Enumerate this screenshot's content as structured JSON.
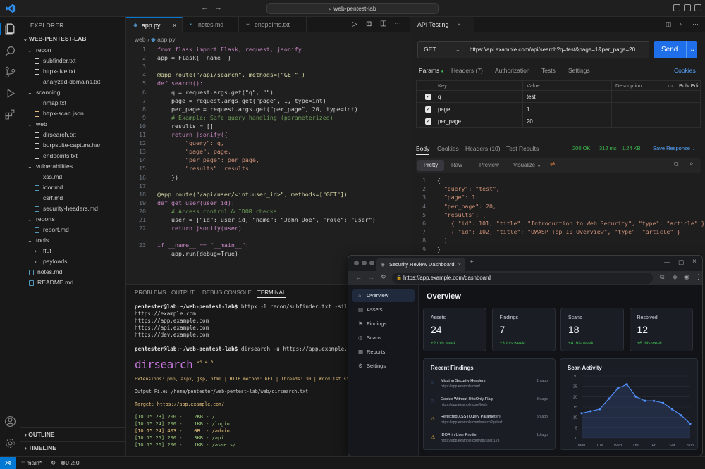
{
  "titlebar": {
    "search": "web-pentest-lab"
  },
  "sidebar": {
    "title": "EXPLORER",
    "project": "WEB-PENTEST-LAB",
    "tree": [
      {
        "label": "recon",
        "type": "folder",
        "open": true,
        "depth": 1
      },
      {
        "label": "subfinder.txt",
        "type": "file",
        "depth": 2,
        "color": "#cccccc"
      },
      {
        "label": "httpx-live.txt",
        "type": "file",
        "depth": 2,
        "color": "#cccccc"
      },
      {
        "label": "analyzed-domains.txt",
        "type": "file",
        "depth": 2,
        "color": "#cccccc"
      },
      {
        "label": "scanning",
        "type": "folder",
        "open": true,
        "depth": 1
      },
      {
        "label": "nmap.txt",
        "type": "file",
        "depth": 2,
        "color": "#cccccc"
      },
      {
        "label": "httpx-scan.json",
        "type": "file",
        "depth": 2,
        "color": "#e5c07b"
      },
      {
        "label": "web",
        "type": "folder",
        "open": true,
        "depth": 1
      },
      {
        "label": "dirsearch.txt",
        "type": "file",
        "depth": 2,
        "color": "#cccccc"
      },
      {
        "label": "burpsuite-capture.har",
        "type": "file",
        "depth": 2,
        "color": "#cccccc"
      },
      {
        "label": "endpoints.txt",
        "type": "file",
        "depth": 2,
        "color": "#cccccc"
      },
      {
        "label": "vulnerabilities",
        "type": "folder",
        "open": true,
        "depth": 1
      },
      {
        "label": "xss.md",
        "type": "file",
        "depth": 2,
        "color": "#519aba"
      },
      {
        "label": "idor.md",
        "type": "file",
        "depth": 2,
        "color": "#519aba"
      },
      {
        "label": "csrf.md",
        "type": "file",
        "depth": 2,
        "color": "#519aba"
      },
      {
        "label": "security-headers.md",
        "type": "file",
        "depth": 2,
        "color": "#519aba"
      },
      {
        "label": "reports",
        "type": "folder",
        "open": true,
        "depth": 1
      },
      {
        "label": "report.md",
        "type": "file",
        "depth": 2,
        "color": "#519aba"
      },
      {
        "label": "tools",
        "type": "folder",
        "open": true,
        "depth": 1
      },
      {
        "label": "ffuf",
        "type": "folder",
        "open": false,
        "depth": 2
      },
      {
        "label": "payloads",
        "type": "folder",
        "open": false,
        "depth": 2
      },
      {
        "label": "notes.md",
        "type": "file",
        "depth": 1,
        "color": "#519aba"
      },
      {
        "label": "README.md",
        "type": "file",
        "depth": 1,
        "color": "#519aba"
      }
    ],
    "outline": "OUTLINE",
    "timeline": "TIMELINE"
  },
  "editor": {
    "tabs": [
      "app.py",
      "notes.md",
      "endpoints.txt"
    ],
    "breadcrumb": [
      "web",
      "app.py"
    ],
    "lines": [
      "from flask import Flask, request, jsonify",
      "app = Flask(__name__)",
      "",
      "@app.route(\"/api/search\", methods=[\"GET\"])",
      "def search():",
      "    q = request.args.get(\"q\", \"\")",
      "    page = request.args.get(\"page\", 1, type=int)",
      "    per_page = request.args.get(\"per_page\", 20, type=int)",
      "    # Example: Safe query handling (parameterized)",
      "    results = []",
      "    return jsonify({",
      "        \"query\": q,",
      "        \"page\": page,",
      "        \"per_page\": per_page,",
      "        \"results\": results",
      "    })",
      "",
      "@app.route(\"/api/user/<int:user_id>\", methods=[\"GET\"])",
      "def get_user(user_id):",
      "    # Access control & IDOR checks",
      "    user = {\"id\": user_id, \"name\": \"John Doe\", \"role\": \"user\"}",
      "    return jsonify(user)",
      "",
      "if __name__ == \"__main__\":",
      "    app.run(debug=True)"
    ],
    "line_numbers": [
      "1",
      "2",
      "3",
      "4",
      "5",
      "6",
      "7",
      "8",
      "9",
      "10",
      "11",
      "12",
      "13",
      "14",
      "15",
      "16",
      "17",
      "18",
      "19",
      "20",
      "21",
      "22",
      "",
      "23"
    ]
  },
  "panel": {
    "tabs": [
      "PROBLEMS",
      "OUTPUT",
      "DEBUG CONSOLE",
      "TERMINAL"
    ],
    "prompt1": "pentester@lab:~/web-pentest-lab$",
    "cmd1": " httpx -l recon/subfinder.txt -silent",
    "out1": [
      "https://example.com",
      "https://app.example.com",
      "https://api.example.com",
      "https://dev.example.com"
    ],
    "prompt2": "pentester@lab:~/web-pentest-lab$",
    "cmd2": " dirsearch -u https://app.example.com -e *",
    "banner": "dirsearch",
    "version": "v0.4.3",
    "ext_line": "Extensions: php, aspx, jsp, html | HTTP method: GET | Threads: 30 | Wordlist size: 11460",
    "output_file": "Output File: /home/pentester/web-pentest-lab/web/dirsearch.txt",
    "target": "Target: https://app.example.com/",
    "results": [
      "[10:15:23] 200 -    2KB - /",
      "[10:15:24] 200 -    1KB - /login",
      "[10:15:24] 403 -    0B  - /admin",
      "[10:15:25] 200 -    3KB - /api",
      "[10:15:26] 200 -    1KB - /assets/"
    ]
  },
  "api": {
    "title": "API Testing",
    "method": "GET",
    "url": "https://api.example.com/api/search?q=test&page=1&per_page=20",
    "send": "Send",
    "req_tabs": [
      "Params",
      "Headers (7)",
      "Authorization",
      "Tests",
      "Settings"
    ],
    "cookies": "Cookies",
    "table_head": [
      "Key",
      "Value",
      "Description",
      "Bulk Edit"
    ],
    "params": [
      {
        "key": "q",
        "value": "test"
      },
      {
        "key": "page",
        "value": "1"
      },
      {
        "key": "per_page",
        "value": "20"
      }
    ],
    "resp_tabs": [
      "Body",
      "Cookies",
      "Headers (10)",
      "Test Results"
    ],
    "status": "200 OK",
    "time": "312 ms",
    "size": "1.24 KB",
    "save": "Save Response",
    "view_tabs": [
      "Pretty",
      "Raw",
      "Preview",
      "Visualize"
    ],
    "json_lines": [
      "{",
      "  \"query\": \"test\",",
      "  \"page\": 1,",
      "  \"per_page\": 20,",
      "  \"results\": [",
      "    { \"id\": 101, \"title\": \"Introduction to Web Security\", \"type\": \"article\" },",
      "    { \"id\": 102, \"title\": \"OWASP Top 10 Overview\", \"type\": \"article\" }",
      "  ]",
      "}"
    ]
  },
  "browser": {
    "tab": "Security Review Dashboard",
    "url": "https://app.example.com/dashboard",
    "nav": [
      "Overview",
      "Assets",
      "Findings",
      "Scans",
      "Reports",
      "Settings"
    ],
    "heading": "Overview",
    "stats": [
      {
        "label": "Assets",
        "value": "24",
        "delta": "+2 this week",
        "color": "#3fb950"
      },
      {
        "label": "Findings",
        "value": "7",
        "delta": "−3 this week",
        "color": "#3fb950"
      },
      {
        "label": "Scans",
        "value": "18",
        "delta": "+4 this week",
        "color": "#3fb950"
      },
      {
        "label": "Resolved",
        "value": "12",
        "delta": "+6 this week",
        "color": "#3fb950"
      }
    ],
    "findings_title": "Recent Findings",
    "findings": [
      {
        "title": "Missing Security Headers",
        "url": "https://app.example.com/",
        "time": "1h ago",
        "color": "#58a6ff"
      },
      {
        "title": "Cookie Without HttpOnly Flag",
        "url": "https://app.example.com/login",
        "time": "3h ago",
        "color": "#58a6ff"
      },
      {
        "title": "Reflected XSS (Query Parameter)",
        "url": "https://app.example.com/search?q=test",
        "time": "5h ago",
        "color": "#e3b341"
      },
      {
        "title": "IDOR in User Profile",
        "url": "https://app.example.com/api/user/123",
        "time": "1d ago",
        "color": "#e3b341"
      }
    ],
    "chart_title": "Scan Activity"
  },
  "chart_data": {
    "type": "line",
    "title": "Scan Activity",
    "categories": [
      "Mon",
      "Tue",
      "Wed",
      "Thu",
      "Fri",
      "Sat",
      "Sun"
    ],
    "x": [
      0,
      0.5,
      1,
      1.5,
      2,
      2.5,
      3,
      3.5,
      4,
      4.5,
      5,
      5.5,
      6
    ],
    "values": [
      12,
      13,
      14,
      19,
      24,
      26,
      20,
      18,
      18,
      17,
      14,
      11,
      7
    ],
    "ylim": [
      0,
      30
    ],
    "yticks": [
      0,
      5,
      10,
      15,
      20,
      25,
      30
    ],
    "color": "#4f8df7"
  },
  "statusbar": {
    "branch": "main*",
    "errors": "0",
    "warnings": "0"
  }
}
